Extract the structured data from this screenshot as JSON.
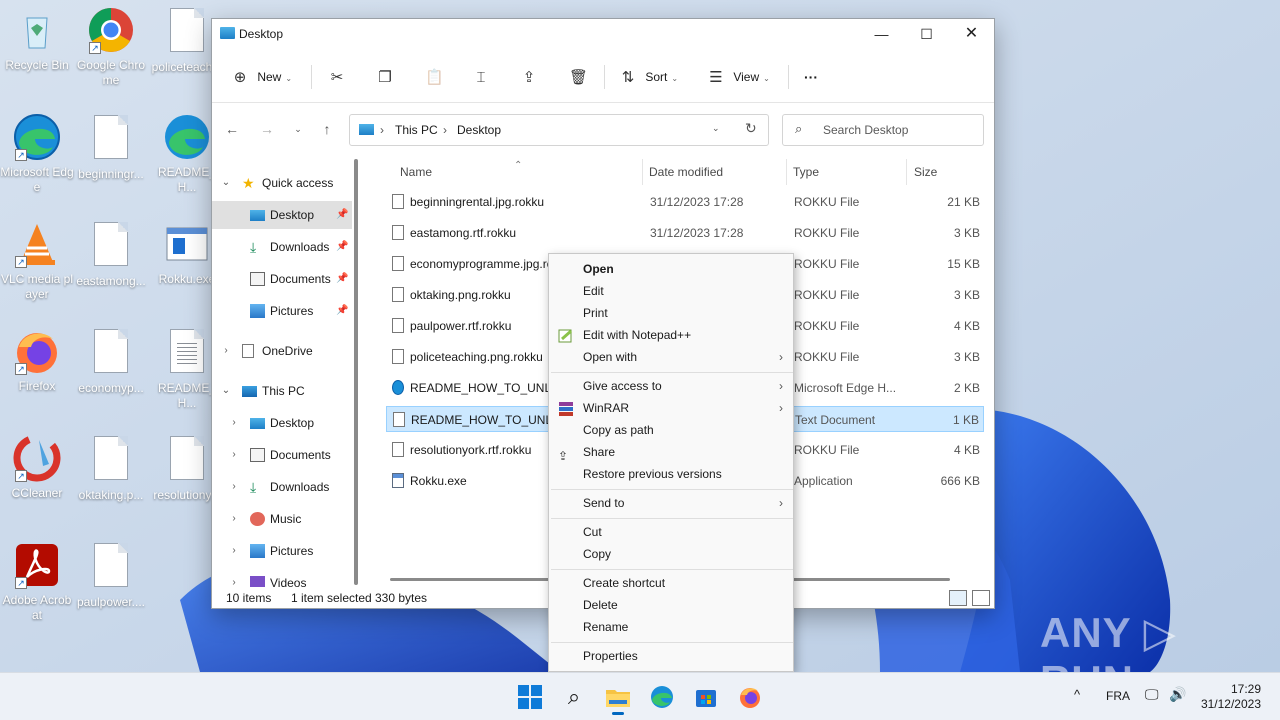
{
  "desktop": {
    "icons": [
      {
        "label": "Recycle Bin"
      },
      {
        "label": "Google Chrome"
      },
      {
        "label": "policeteach..."
      },
      {
        "label": "Microsoft Edge"
      },
      {
        "label": "beginningr..."
      },
      {
        "label": "README_H..."
      },
      {
        "label": "VLC media player"
      },
      {
        "label": "eastamong..."
      },
      {
        "label": "Rokku.exe"
      },
      {
        "label": "Firefox"
      },
      {
        "label": "economyp..."
      },
      {
        "label": "README_H..."
      },
      {
        "label": "CCleaner"
      },
      {
        "label": "oktaking.p..."
      },
      {
        "label": "resolutiony..."
      },
      {
        "label": "Adobe Acrobat"
      },
      {
        "label": "paulpower...."
      }
    ]
  },
  "explorer": {
    "title": "Desktop",
    "commands": {
      "new": "New",
      "sort": "Sort",
      "view": "View",
      "more": "···"
    },
    "address": {
      "crumb1": "This PC",
      "crumb2": "Desktop",
      "sep": "›"
    },
    "search_placeholder": "Search Desktop",
    "nav": [
      {
        "label": "Quick access"
      },
      {
        "label": "Desktop"
      },
      {
        "label": "Downloads"
      },
      {
        "label": "Documents"
      },
      {
        "label": "Pictures"
      },
      {
        "label": "OneDrive"
      },
      {
        "label": "This PC"
      },
      {
        "label": "Desktop"
      },
      {
        "label": "Documents"
      },
      {
        "label": "Downloads"
      },
      {
        "label": "Music"
      },
      {
        "label": "Pictures"
      },
      {
        "label": "Videos"
      }
    ],
    "columns": {
      "name": "Name",
      "date": "Date modified",
      "type": "Type",
      "size": "Size"
    },
    "files": [
      {
        "name": "beginningrental.jpg.rokku",
        "date": "31/12/2023 17:28",
        "type": "ROKKU File",
        "size": "21 KB"
      },
      {
        "name": "eastamong.rtf.rokku",
        "date": "31/12/2023 17:28",
        "type": "ROKKU File",
        "size": "3 KB"
      },
      {
        "name": "economyprogramme.jpg.rokku",
        "date": "",
        "type": "ROKKU File",
        "size": "15 KB"
      },
      {
        "name": "oktaking.png.rokku",
        "date": "",
        "type": "ROKKU File",
        "size": "3 KB"
      },
      {
        "name": "paulpower.rtf.rokku",
        "date": "",
        "type": "ROKKU File",
        "size": "4 KB"
      },
      {
        "name": "policeteaching.png.rokku",
        "date": "",
        "type": "ROKKU File",
        "size": "3 KB"
      },
      {
        "name": "README_HOW_TO_UNLOCK.html",
        "date": "",
        "type": "Microsoft Edge H...",
        "size": "2 KB"
      },
      {
        "name": "README_HOW_TO_UNLOCK.txt",
        "date": "",
        "type": "Text Document",
        "size": "1 KB"
      },
      {
        "name": "resolutionyork.rtf.rokku",
        "date": "",
        "type": "ROKKU File",
        "size": "4 KB"
      },
      {
        "name": "Rokku.exe",
        "date": "",
        "type": "Application",
        "size": "666 KB"
      }
    ],
    "status": {
      "count": "10 items",
      "selected": "1 item selected",
      "bytes": "330 bytes"
    }
  },
  "context_menu": {
    "items": [
      {
        "label": "Open"
      },
      {
        "label": "Edit"
      },
      {
        "label": "Print"
      },
      {
        "label": "Edit with Notepad++"
      },
      {
        "label": "Open with"
      },
      {
        "label": "Give access to"
      },
      {
        "label": "WinRAR"
      },
      {
        "label": "Copy as path"
      },
      {
        "label": "Share"
      },
      {
        "label": "Restore previous versions"
      },
      {
        "label": "Send to"
      },
      {
        "label": "Cut"
      },
      {
        "label": "Copy"
      },
      {
        "label": "Create shortcut"
      },
      {
        "label": "Delete"
      },
      {
        "label": "Rename"
      },
      {
        "label": "Properties"
      }
    ],
    "submenu_arrow": "›"
  },
  "taskbar": {
    "language": "FRA",
    "time": "17:29",
    "date": "31/12/2023",
    "tray_chevron": "^"
  },
  "watermark": "ANY ▷ RUN",
  "colors": {
    "accent": "#0067c0",
    "selection": "#cce8ff",
    "wallpaper": "#c9d7e8",
    "bloom": "#1d4fd6"
  }
}
